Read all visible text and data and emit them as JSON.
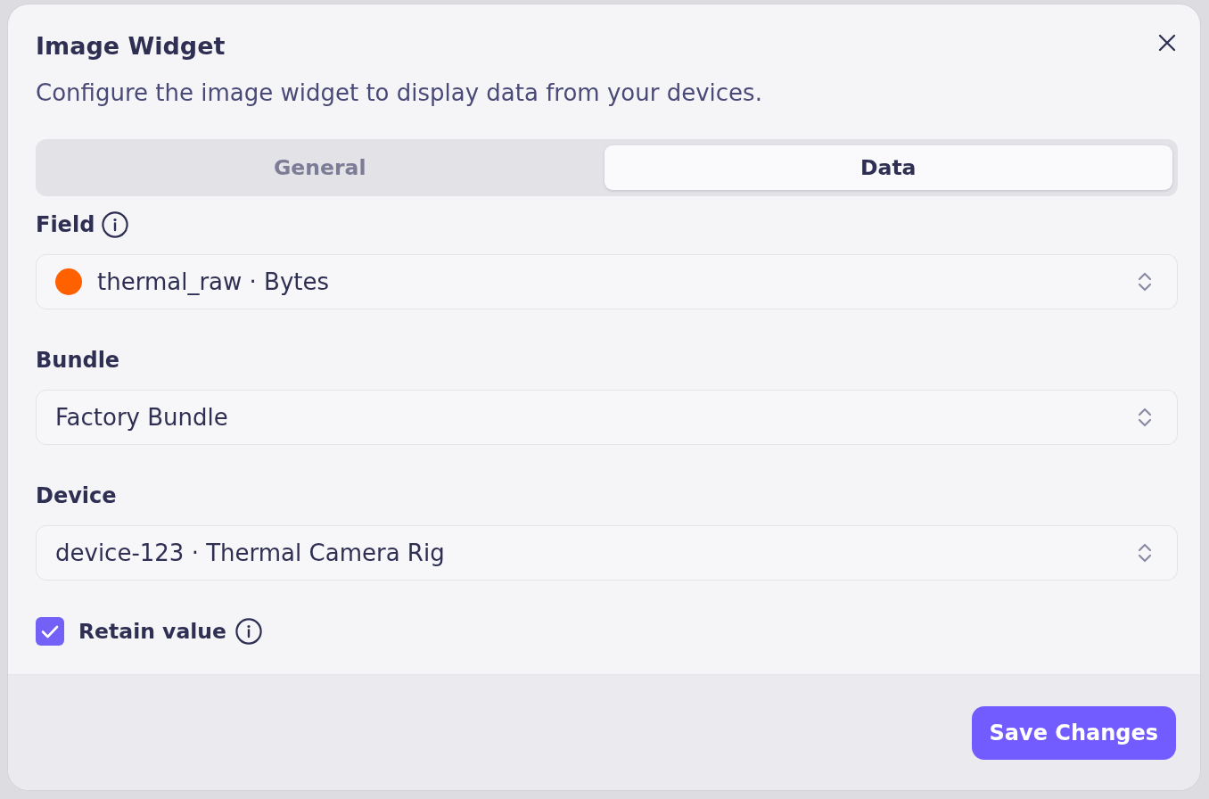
{
  "dialog": {
    "title": "Image Widget",
    "description": "Configure the image widget to display data from your devices."
  },
  "tabs": [
    {
      "label": "General",
      "selected": false
    },
    {
      "label": "Data",
      "selected": true
    }
  ],
  "fields": [
    {
      "label": "Field",
      "info": true,
      "value": "thermal_raw · Bytes",
      "color": "#ff6000"
    },
    {
      "label": "Bundle",
      "info": false,
      "value": "Factory Bundle"
    },
    {
      "label": "Device",
      "info": false,
      "value": "device-123 · Thermal Camera Rig"
    }
  ],
  "retain": {
    "label": "Retain value",
    "checked": true,
    "info": true
  },
  "footer": {
    "buttons": [
      "Save Changes"
    ]
  }
}
